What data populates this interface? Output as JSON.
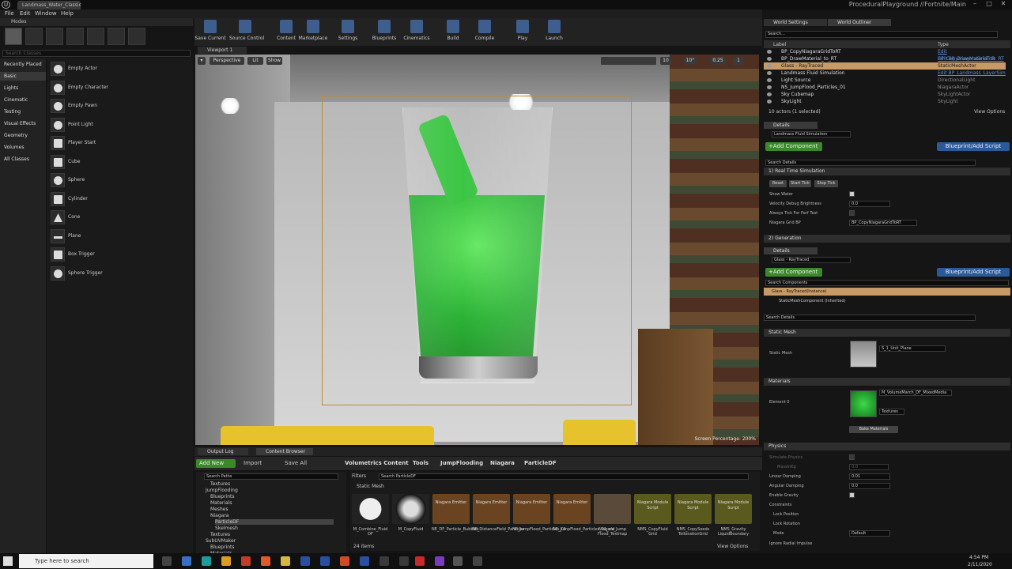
{
  "window": {
    "tab": "Landmass_Water_Classic",
    "project": "ProceduralPlayground //Fortnite/Main",
    "controls": [
      "–",
      "□",
      "✕"
    ]
  },
  "menu": [
    "File",
    "Edit",
    "Window",
    "Help"
  ],
  "modes": {
    "title": "Modes",
    "search_placeholder": "Search Classes",
    "categories": [
      "Recently Placed",
      "Basic",
      "Lights",
      "Cinematic",
      "Testing",
      "Visual Effects",
      "Geometry",
      "Volumes",
      "All Classes"
    ],
    "classes": [
      "Empty Actor",
      "Empty Character",
      "Empty Pawn",
      "Point Light",
      "Player Start",
      "Cube",
      "Sphere",
      "Cylinder",
      "Cone",
      "Plane",
      "Box Trigger",
      "Sphere Trigger"
    ]
  },
  "toolbar": [
    "Save Current",
    "Source Control",
    "Content",
    "Marketplace",
    "Settings",
    "Blueprints",
    "Cinematics",
    "Build",
    "Compile",
    "Play",
    "Launch"
  ],
  "viewport": {
    "tab": "Viewport 1",
    "perspective": "Perspective",
    "lit": "Lit",
    "show": "Show",
    "grid": "10",
    "angle": "10°",
    "scale": "0.25",
    "cam": "1",
    "screen_pct": "Screen Percentage: 200%"
  },
  "world_settings": "World Settings",
  "outliner": {
    "title": "World Outliner",
    "search_placeholder": "Search...",
    "col_label": "Label",
    "col_type": "Type",
    "rows": [
      {
        "label": "BP_CopyNiagaraGridToRT",
        "type": "Edit BP_CopyNiagaraGridToR",
        "link": true,
        "sel": false
      },
      {
        "label": "BP_DrawMaterial_to_RT",
        "type": "Edit BP_DrawMaterial_to_RT",
        "link": true,
        "sel": false
      },
      {
        "label": "Glass - RayTraced",
        "type": "StaticMeshActor",
        "link": false,
        "sel": true
      },
      {
        "label": "Landmass Fluid Simulation",
        "type": "Edit BP_Landmass_LayerSim",
        "link": true,
        "sel": false
      },
      {
        "label": "Light Source",
        "type": "DirectionalLight",
        "link": false,
        "sel": false
      },
      {
        "label": "NS_JumpFlood_Particles_01",
        "type": "NiagaraActor",
        "link": false,
        "sel": false
      },
      {
        "label": "Sky Cubemap",
        "type": "SkyLightActor",
        "link": false,
        "sel": false
      },
      {
        "label": "SkyLight",
        "type": "SkyLight",
        "link": false,
        "sel": false
      }
    ],
    "status": "10 actors (1 selected)",
    "view_options": "View Options"
  },
  "details1": {
    "tab": "Details",
    "name": "Landmass Fluid Simulation",
    "add": "+Add Component",
    "bp": "Blueprint/Add Script",
    "search_placeholder": "Search Details",
    "section": "1) Real Time Simulation",
    "buttons": [
      "Reset",
      "Start Tick",
      "Stop Tick"
    ],
    "props": [
      "Show Water",
      "Velocity Debug Brightness",
      "Always Tick For Perf Test",
      "Niagara Grid BP"
    ],
    "velocity": "0.0",
    "grid_bp": "BP_CopyNiagaraGridToRT",
    "section2": "2) Generation"
  },
  "details2": {
    "tab": "Details",
    "name": "Glass - RayTraced",
    "add": "+Add Component",
    "bp": "Blueprint/Add Script",
    "search_components": "Search Components",
    "instance": "Glass - RayTraced(Instance)",
    "component": "StaticMeshComponent (Inherited)",
    "search_details": "Search Details",
    "static_mesh_hdr": "Static Mesh",
    "static_mesh_lbl": "Static Mesh",
    "mesh": "S_1_Unit_Plane",
    "materials_hdr": "Materials",
    "element": "Element 0",
    "material": "M_VolumeMarch_DF_MixedMedia",
    "textures": "Textures",
    "bake": "Bake Materials",
    "physics_hdr": "Physics",
    "phys": [
      "Simulate Physics",
      "MassInKg",
      "Linear Damping",
      "Angular Damping",
      "Enable Gravity",
      "Constraints",
      "Lock Position",
      "Lock Rotation",
      "Mode",
      "Ignore Radial Impulse"
    ],
    "mass": "0.0",
    "lin": "0.01",
    "ang": "0.0",
    "mode": "Default"
  },
  "bottom": {
    "tabs": [
      "Output Log",
      "Content Browser"
    ],
    "add_new": "Add New",
    "import": "Import",
    "save_all": "Save All",
    "crumbs": [
      "Volumetrics Content",
      "Tools",
      "JumpFlooding",
      "Niagara",
      "ParticleDF"
    ],
    "search_paths": "Search Paths",
    "filters": "Filters",
    "search_asset": "Search ParticleDF",
    "group": "Static Mesh",
    "tree": [
      "Textures",
      "JumpFlooding",
      "Blueprints",
      "Materials",
      "Meshes",
      "Niagara",
      "ParticleDF",
      "Skelmesh",
      "Textures",
      "SubUVMaker",
      "Blueprints",
      "Materials"
    ],
    "assets": [
      {
        "top": "",
        "name": "M_Combine_Fluid DF",
        "kind": "sphere"
      },
      {
        "top": "",
        "name": "M_CopyFluid",
        "kind": "sphere2"
      },
      {
        "top": "Niagara Emitter",
        "name": "NE_DF_Particle_Bubbles",
        "kind": "emit"
      },
      {
        "top": "Niagara Emitter",
        "name": "NE_DistanceField_Particles",
        "kind": "emit"
      },
      {
        "top": "Niagara Emitter",
        "name": "NE_JumpFlood_Particles_01",
        "kind": "emit"
      },
      {
        "top": "Niagara Emitter",
        "name": "NE_JumpFlood_Particles_01_old",
        "kind": "emit"
      },
      {
        "top": "",
        "name": "Niagara_Jump Flood_Testmap",
        "kind": "map"
      },
      {
        "top": "Niagara Module Script",
        "name": "NMS_CopyFluid Grid",
        "kind": "mod"
      },
      {
        "top": "Niagara Module Script",
        "name": "NMS_CopySeeds ToIterationGrid",
        "kind": "mod"
      },
      {
        "top": "Niagara Module Script",
        "name": "NMS_Gravity LiquidBoundary",
        "kind": "mod"
      }
    ],
    "count": "24 items",
    "view_options": "View Options"
  },
  "taskbar": {
    "search": "Type here to search",
    "time": "4:54 PM",
    "date": "2/11/2020"
  },
  "colors": {
    "green": "#3a8a2a",
    "blue": "#2a5a9a",
    "selection": "#c89a66"
  }
}
